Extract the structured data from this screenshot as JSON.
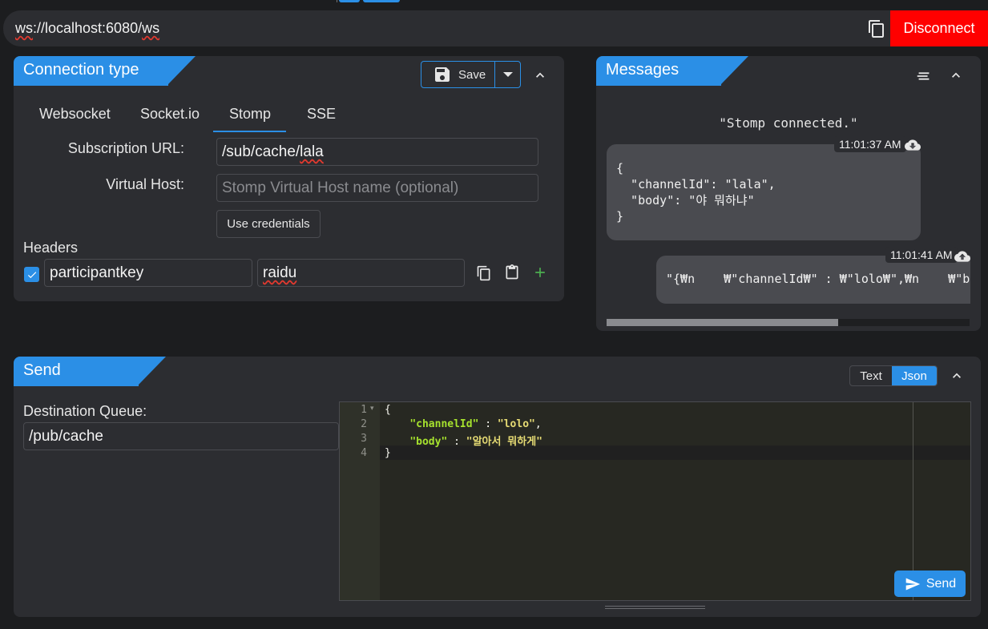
{
  "url_bar": {
    "url_prefix": "ws",
    "url_rest": "://localhost:6080/",
    "url_suffix": "ws",
    "disconnect_label": "Disconnect"
  },
  "connection": {
    "title": "Connection type",
    "save_label": "Save",
    "tabs": [
      "Websocket",
      "Socket.io",
      "Stomp",
      "SSE"
    ],
    "active_tab": "Stomp",
    "subscription_url_label": "Subscription URL:",
    "subscription_url_prefix": "/sub/cache/",
    "subscription_url_tail": "lala",
    "virtual_host_label": "Virtual Host:",
    "virtual_host_placeholder": "Stomp Virtual Host name (optional)",
    "use_credentials_label": "Use credentials",
    "headers_label": "Headers",
    "header_key": "participantkey",
    "header_value": "raidu",
    "header_enabled": true
  },
  "messages": {
    "title": "Messages",
    "status": "\"Stomp connected.\"",
    "items": [
      {
        "time": "11:01:37 AM",
        "direction": "received",
        "body": "{\n  \"channelId\": \"lala\",\n  \"body\": \"야 뭐하냐\"\n}"
      },
      {
        "time": "11:01:41 AM",
        "direction": "sent",
        "body": "\"{₩n    ₩\"channelId₩\" : ₩\"lolo₩\",₩n    ₩\"b"
      }
    ]
  },
  "send": {
    "title": "Send",
    "mode_text": "Text",
    "mode_json": "Json",
    "active_mode": "Json",
    "destination_label": "Destination Queue:",
    "destination_value": "/pub/cache",
    "line_numbers": [
      "1",
      "2",
      "3",
      "4"
    ],
    "code": {
      "open": "{",
      "key1": "\"channelId\"",
      "sep1": " : ",
      "val1": "\"lolo\"",
      "comma": ",",
      "key2": "\"body\"",
      "sep2": " : ",
      "val2": "\"알아서 뭐하게\"",
      "close": "}"
    },
    "send_label": "Send"
  },
  "colors": {
    "accent": "#2b8fe6",
    "disconnect": "#ff0000",
    "panel_bg": "#2c2d31",
    "page_bg": "#1c1d1f",
    "editor_bg": "#272822"
  }
}
